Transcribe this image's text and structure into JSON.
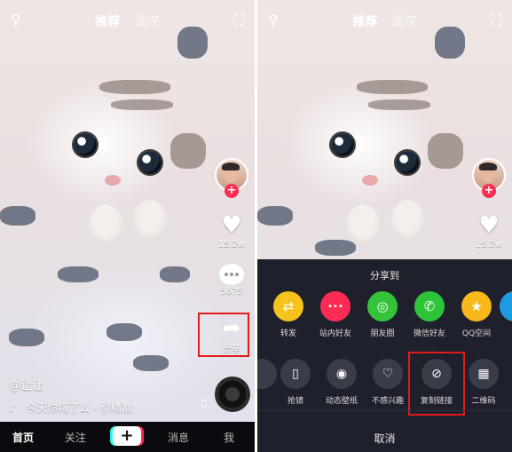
{
  "top": {
    "tab_recommend": "推荐",
    "tab_city": "武汉"
  },
  "rail": {
    "like_count": "15.2w",
    "comment_count": "5675",
    "share_label": "分享"
  },
  "caption": {
    "author": "@让让",
    "music": "今天你嗨了么 - 引精准"
  },
  "nav": {
    "home": "首页",
    "follow": "关注",
    "plus": "+",
    "messages": "消息",
    "me": "我"
  },
  "sheet": {
    "title": "分享到",
    "share_targets": [
      {
        "label": "转发",
        "color": "#f6c21c",
        "icon": "repost-icon",
        "glyph": "⇄"
      },
      {
        "label": "站内好友",
        "color": "#fe2c55",
        "icon": "chat-bubble-icon",
        "glyph": "•••"
      },
      {
        "label": "朋友圈",
        "color": "#34c33b",
        "icon": "moments-icon",
        "glyph": "◎"
      },
      {
        "label": "微信好友",
        "color": "#2dc43a",
        "icon": "wechat-icon",
        "glyph": "✆"
      },
      {
        "label": "QQ空间",
        "color": "#f6b81a",
        "icon": "qzone-star-icon",
        "glyph": "★"
      }
    ],
    "actions": [
      {
        "label": "抢镜",
        "icon": "duet-icon",
        "glyph": "▯"
      },
      {
        "label": "动态壁纸",
        "icon": "live-wallpaper-icon",
        "glyph": "◉"
      },
      {
        "label": "不感兴趣",
        "icon": "broken-heart-icon",
        "glyph": "♡"
      },
      {
        "label": "复制链接",
        "icon": "link-icon",
        "glyph": "⊘"
      },
      {
        "label": "二维码",
        "icon": "qr-code-icon",
        "glyph": "▦"
      }
    ],
    "cancel": "取消"
  }
}
